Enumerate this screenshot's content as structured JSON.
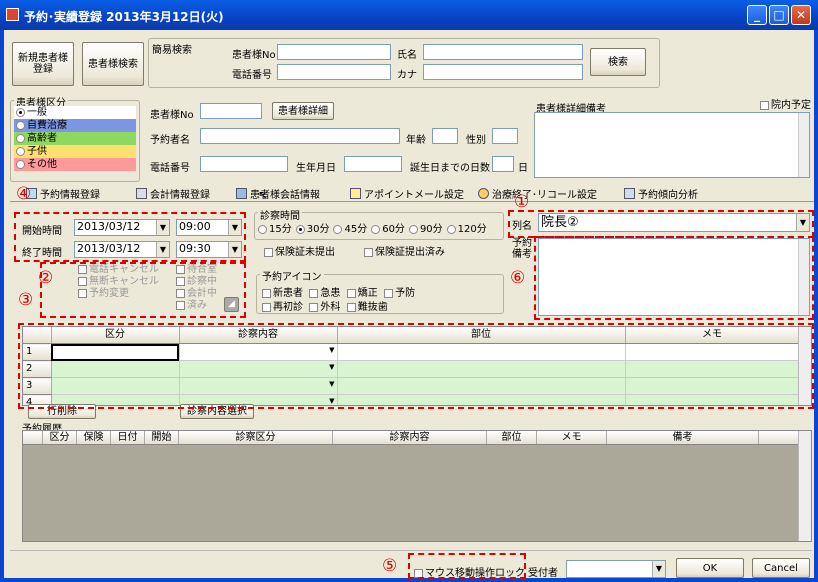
{
  "window": {
    "title": "予約･実績登録  2013年3月12日(火)"
  },
  "top_buttons": {
    "new_patient": "新規患者様\n登録",
    "patient_search": "患者様検索"
  },
  "quick_search": {
    "label": "簡易検索",
    "patient_no_label": "患者様No",
    "name_label": "氏名",
    "phone_label": "電話番号",
    "kana_label": "カナ",
    "search_button": "検索"
  },
  "patient_category": {
    "label": "患者様区分",
    "options": [
      "一般",
      "自費治療",
      "高齢者",
      "子供",
      "その他"
    ],
    "colors": [
      "#ffffff",
      "#7b96e4",
      "#8fd860",
      "#ffe070",
      "#ff9a9a"
    ],
    "selected": 0
  },
  "patient_info": {
    "patient_no_label": "患者様No",
    "details_button": "患者様詳細",
    "reserver_label": "予約者名",
    "age_label": "年齢",
    "gender_label": "性別",
    "phone_label": "電話番号",
    "birthday_label": "生年月日",
    "days_to_birthday_label": "誕生日までの日数",
    "days_unit": "日",
    "notes_label": "患者様詳細備考",
    "in_clinic_label": "院内予定"
  },
  "tabs": [
    "予約情報登録",
    "会計情報登録",
    "患者様会話情報",
    "アポイントメール設定",
    "治療終了･リコール設定",
    "予約傾向分析"
  ],
  "schedule": {
    "start_label": "開始時間",
    "start_date": "2013/03/12",
    "start_time": "09:00",
    "end_label": "終了時間",
    "end_date": "2013/03/12",
    "end_time": "09:30"
  },
  "exam_time": {
    "label": "診察時間",
    "options": [
      "15分",
      "30分",
      "45分",
      "60分",
      "90分",
      "120分"
    ],
    "selected": 1,
    "insurance_not_submitted": "保険証未提出",
    "insurance_submitted": "保険証提出済み"
  },
  "status_checks": {
    "left": [
      "電話キャンセル",
      "無断キャンセル",
      "予約変更"
    ],
    "right": [
      "待合室",
      "診察中",
      "会計中",
      "済み"
    ]
  },
  "reserve_icons": {
    "label": "予約アイコン",
    "row1": [
      "新患者",
      "急患",
      "矯正",
      "予防"
    ],
    "row2": [
      "再初診",
      "外科",
      "難抜歯"
    ]
  },
  "column": {
    "label": "列名",
    "value": "院長②"
  },
  "reserve_notes": {
    "label": "予約\n備考"
  },
  "grid": {
    "headers": [
      "区分",
      "診察内容",
      "部位",
      "メモ"
    ],
    "rows": [
      "1",
      "2",
      "3",
      "4"
    ]
  },
  "grid_buttons": {
    "delete_row": "行削除",
    "select_content": "診察内容選択"
  },
  "history": {
    "label": "予約履歴",
    "headers": [
      "区分",
      "保険",
      "日付",
      "開始",
      "診察区分",
      "診察内容",
      "部位",
      "メモ",
      "備考"
    ]
  },
  "footer": {
    "mouse_lock": "マウス移動操作ロック",
    "receptionist_label": "受付者",
    "ok": "OK",
    "cancel": "Cancel"
  },
  "annotations": [
    "①",
    "②",
    "③",
    "④",
    "⑤",
    "⑥"
  ]
}
